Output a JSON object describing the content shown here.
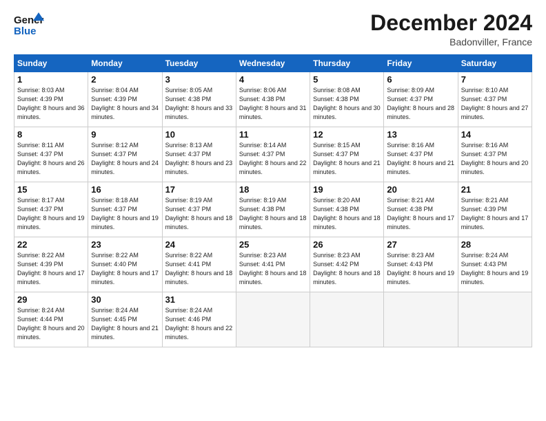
{
  "header": {
    "logo_line1": "General",
    "logo_line2": "Blue",
    "month_title": "December 2024",
    "location": "Badonviller, France"
  },
  "days_of_week": [
    "Sunday",
    "Monday",
    "Tuesday",
    "Wednesday",
    "Thursday",
    "Friday",
    "Saturday"
  ],
  "weeks": [
    [
      {
        "day": 1,
        "sunrise": "8:03 AM",
        "sunset": "4:39 PM",
        "daylight": "8 hours and 36 minutes."
      },
      {
        "day": 2,
        "sunrise": "8:04 AM",
        "sunset": "4:39 PM",
        "daylight": "8 hours and 34 minutes."
      },
      {
        "day": 3,
        "sunrise": "8:05 AM",
        "sunset": "4:38 PM",
        "daylight": "8 hours and 33 minutes."
      },
      {
        "day": 4,
        "sunrise": "8:06 AM",
        "sunset": "4:38 PM",
        "daylight": "8 hours and 31 minutes."
      },
      {
        "day": 5,
        "sunrise": "8:08 AM",
        "sunset": "4:38 PM",
        "daylight": "8 hours and 30 minutes."
      },
      {
        "day": 6,
        "sunrise": "8:09 AM",
        "sunset": "4:37 PM",
        "daylight": "8 hours and 28 minutes."
      },
      {
        "day": 7,
        "sunrise": "8:10 AM",
        "sunset": "4:37 PM",
        "daylight": "8 hours and 27 minutes."
      }
    ],
    [
      {
        "day": 8,
        "sunrise": "8:11 AM",
        "sunset": "4:37 PM",
        "daylight": "8 hours and 26 minutes."
      },
      {
        "day": 9,
        "sunrise": "8:12 AM",
        "sunset": "4:37 PM",
        "daylight": "8 hours and 24 minutes."
      },
      {
        "day": 10,
        "sunrise": "8:13 AM",
        "sunset": "4:37 PM",
        "daylight": "8 hours and 23 minutes."
      },
      {
        "day": 11,
        "sunrise": "8:14 AM",
        "sunset": "4:37 PM",
        "daylight": "8 hours and 22 minutes."
      },
      {
        "day": 12,
        "sunrise": "8:15 AM",
        "sunset": "4:37 PM",
        "daylight": "8 hours and 21 minutes."
      },
      {
        "day": 13,
        "sunrise": "8:16 AM",
        "sunset": "4:37 PM",
        "daylight": "8 hours and 21 minutes."
      },
      {
        "day": 14,
        "sunrise": "8:16 AM",
        "sunset": "4:37 PM",
        "daylight": "8 hours and 20 minutes."
      }
    ],
    [
      {
        "day": 15,
        "sunrise": "8:17 AM",
        "sunset": "4:37 PM",
        "daylight": "8 hours and 19 minutes."
      },
      {
        "day": 16,
        "sunrise": "8:18 AM",
        "sunset": "4:37 PM",
        "daylight": "8 hours and 19 minutes."
      },
      {
        "day": 17,
        "sunrise": "8:19 AM",
        "sunset": "4:37 PM",
        "daylight": "8 hours and 18 minutes."
      },
      {
        "day": 18,
        "sunrise": "8:19 AM",
        "sunset": "4:38 PM",
        "daylight": "8 hours and 18 minutes."
      },
      {
        "day": 19,
        "sunrise": "8:20 AM",
        "sunset": "4:38 PM",
        "daylight": "8 hours and 18 minutes."
      },
      {
        "day": 20,
        "sunrise": "8:21 AM",
        "sunset": "4:38 PM",
        "daylight": "8 hours and 17 minutes."
      },
      {
        "day": 21,
        "sunrise": "8:21 AM",
        "sunset": "4:39 PM",
        "daylight": "8 hours and 17 minutes."
      }
    ],
    [
      {
        "day": 22,
        "sunrise": "8:22 AM",
        "sunset": "4:39 PM",
        "daylight": "8 hours and 17 minutes."
      },
      {
        "day": 23,
        "sunrise": "8:22 AM",
        "sunset": "4:40 PM",
        "daylight": "8 hours and 17 minutes."
      },
      {
        "day": 24,
        "sunrise": "8:22 AM",
        "sunset": "4:41 PM",
        "daylight": "8 hours and 18 minutes."
      },
      {
        "day": 25,
        "sunrise": "8:23 AM",
        "sunset": "4:41 PM",
        "daylight": "8 hours and 18 minutes."
      },
      {
        "day": 26,
        "sunrise": "8:23 AM",
        "sunset": "4:42 PM",
        "daylight": "8 hours and 18 minutes."
      },
      {
        "day": 27,
        "sunrise": "8:23 AM",
        "sunset": "4:43 PM",
        "daylight": "8 hours and 19 minutes."
      },
      {
        "day": 28,
        "sunrise": "8:24 AM",
        "sunset": "4:43 PM",
        "daylight": "8 hours and 19 minutes."
      }
    ],
    [
      {
        "day": 29,
        "sunrise": "8:24 AM",
        "sunset": "4:44 PM",
        "daylight": "8 hours and 20 minutes."
      },
      {
        "day": 30,
        "sunrise": "8:24 AM",
        "sunset": "4:45 PM",
        "daylight": "8 hours and 21 minutes."
      },
      {
        "day": 31,
        "sunrise": "8:24 AM",
        "sunset": "4:46 PM",
        "daylight": "8 hours and 22 minutes."
      },
      null,
      null,
      null,
      null
    ]
  ]
}
